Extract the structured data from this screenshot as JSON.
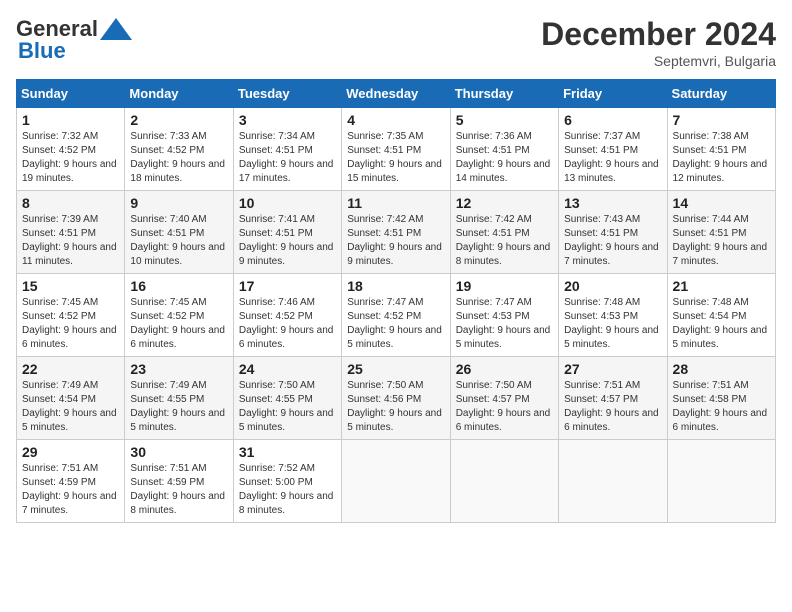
{
  "header": {
    "logo_general": "General",
    "logo_blue": "Blue",
    "month": "December 2024",
    "location": "Septemvri, Bulgaria"
  },
  "weekdays": [
    "Sunday",
    "Monday",
    "Tuesday",
    "Wednesday",
    "Thursday",
    "Friday",
    "Saturday"
  ],
  "weeks": [
    [
      {
        "day": "1",
        "sunrise": "7:32 AM",
        "sunset": "4:52 PM",
        "daylight": "9 hours and 19 minutes."
      },
      {
        "day": "2",
        "sunrise": "7:33 AM",
        "sunset": "4:52 PM",
        "daylight": "9 hours and 18 minutes."
      },
      {
        "day": "3",
        "sunrise": "7:34 AM",
        "sunset": "4:51 PM",
        "daylight": "9 hours and 17 minutes."
      },
      {
        "day": "4",
        "sunrise": "7:35 AM",
        "sunset": "4:51 PM",
        "daylight": "9 hours and 15 minutes."
      },
      {
        "day": "5",
        "sunrise": "7:36 AM",
        "sunset": "4:51 PM",
        "daylight": "9 hours and 14 minutes."
      },
      {
        "day": "6",
        "sunrise": "7:37 AM",
        "sunset": "4:51 PM",
        "daylight": "9 hours and 13 minutes."
      },
      {
        "day": "7",
        "sunrise": "7:38 AM",
        "sunset": "4:51 PM",
        "daylight": "9 hours and 12 minutes."
      }
    ],
    [
      {
        "day": "8",
        "sunrise": "7:39 AM",
        "sunset": "4:51 PM",
        "daylight": "9 hours and 11 minutes."
      },
      {
        "day": "9",
        "sunrise": "7:40 AM",
        "sunset": "4:51 PM",
        "daylight": "9 hours and 10 minutes."
      },
      {
        "day": "10",
        "sunrise": "7:41 AM",
        "sunset": "4:51 PM",
        "daylight": "9 hours and 9 minutes."
      },
      {
        "day": "11",
        "sunrise": "7:42 AM",
        "sunset": "4:51 PM",
        "daylight": "9 hours and 9 minutes."
      },
      {
        "day": "12",
        "sunrise": "7:42 AM",
        "sunset": "4:51 PM",
        "daylight": "9 hours and 8 minutes."
      },
      {
        "day": "13",
        "sunrise": "7:43 AM",
        "sunset": "4:51 PM",
        "daylight": "9 hours and 7 minutes."
      },
      {
        "day": "14",
        "sunrise": "7:44 AM",
        "sunset": "4:51 PM",
        "daylight": "9 hours and 7 minutes."
      }
    ],
    [
      {
        "day": "15",
        "sunrise": "7:45 AM",
        "sunset": "4:52 PM",
        "daylight": "9 hours and 6 minutes."
      },
      {
        "day": "16",
        "sunrise": "7:45 AM",
        "sunset": "4:52 PM",
        "daylight": "9 hours and 6 minutes."
      },
      {
        "day": "17",
        "sunrise": "7:46 AM",
        "sunset": "4:52 PM",
        "daylight": "9 hours and 6 minutes."
      },
      {
        "day": "18",
        "sunrise": "7:47 AM",
        "sunset": "4:52 PM",
        "daylight": "9 hours and 5 minutes."
      },
      {
        "day": "19",
        "sunrise": "7:47 AM",
        "sunset": "4:53 PM",
        "daylight": "9 hours and 5 minutes."
      },
      {
        "day": "20",
        "sunrise": "7:48 AM",
        "sunset": "4:53 PM",
        "daylight": "9 hours and 5 minutes."
      },
      {
        "day": "21",
        "sunrise": "7:48 AM",
        "sunset": "4:54 PM",
        "daylight": "9 hours and 5 minutes."
      }
    ],
    [
      {
        "day": "22",
        "sunrise": "7:49 AM",
        "sunset": "4:54 PM",
        "daylight": "9 hours and 5 minutes."
      },
      {
        "day": "23",
        "sunrise": "7:49 AM",
        "sunset": "4:55 PM",
        "daylight": "9 hours and 5 minutes."
      },
      {
        "day": "24",
        "sunrise": "7:50 AM",
        "sunset": "4:55 PM",
        "daylight": "9 hours and 5 minutes."
      },
      {
        "day": "25",
        "sunrise": "7:50 AM",
        "sunset": "4:56 PM",
        "daylight": "9 hours and 5 minutes."
      },
      {
        "day": "26",
        "sunrise": "7:50 AM",
        "sunset": "4:57 PM",
        "daylight": "9 hours and 6 minutes."
      },
      {
        "day": "27",
        "sunrise": "7:51 AM",
        "sunset": "4:57 PM",
        "daylight": "9 hours and 6 minutes."
      },
      {
        "day": "28",
        "sunrise": "7:51 AM",
        "sunset": "4:58 PM",
        "daylight": "9 hours and 6 minutes."
      }
    ],
    [
      {
        "day": "29",
        "sunrise": "7:51 AM",
        "sunset": "4:59 PM",
        "daylight": "9 hours and 7 minutes."
      },
      {
        "day": "30",
        "sunrise": "7:51 AM",
        "sunset": "4:59 PM",
        "daylight": "9 hours and 8 minutes."
      },
      {
        "day": "31",
        "sunrise": "7:52 AM",
        "sunset": "5:00 PM",
        "daylight": "9 hours and 8 minutes."
      },
      null,
      null,
      null,
      null
    ]
  ]
}
